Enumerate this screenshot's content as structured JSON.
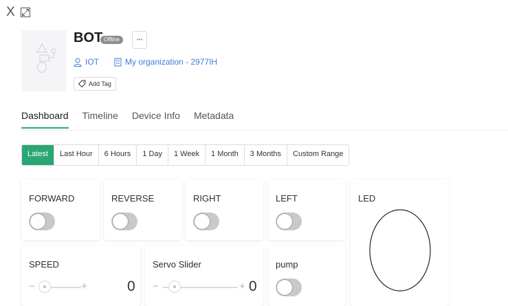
{
  "window": {
    "close_label": "X",
    "expand_icon": "expand-icon"
  },
  "device": {
    "name": "BOT",
    "status": "Offline",
    "more_label": "•••",
    "template": "IOT",
    "organization": "My organization - 2977IH",
    "add_tag_label": "Add Tag"
  },
  "tabs": [
    {
      "label": "Dashboard",
      "active": true
    },
    {
      "label": "Timeline",
      "active": false
    },
    {
      "label": "Device Info",
      "active": false
    },
    {
      "label": "Metadata",
      "active": false
    }
  ],
  "time_ranges": [
    {
      "label": "Latest",
      "active": true
    },
    {
      "label": "Last Hour",
      "active": false
    },
    {
      "label": "6 Hours",
      "active": false
    },
    {
      "label": "1 Day",
      "active": false
    },
    {
      "label": "1 Week",
      "active": false
    },
    {
      "label": "1 Month",
      "active": false
    },
    {
      "label": "3 Months",
      "active": false
    },
    {
      "label": "Custom Range",
      "active": false
    }
  ],
  "widgets": {
    "forward": {
      "label": "FORWARD",
      "on": false
    },
    "reverse": {
      "label": "REVERSE",
      "on": false
    },
    "right": {
      "label": "RIGHT",
      "on": false
    },
    "left": {
      "label": "LEFT",
      "on": false
    },
    "led": {
      "label": "LED",
      "on": false
    },
    "speed": {
      "label": "SPEED",
      "value": "0",
      "minus": "−",
      "plus": "+"
    },
    "servo": {
      "label": "Servo Slider",
      "value": "0",
      "minus": "−",
      "plus": "+"
    },
    "pump": {
      "label": "pump",
      "on": false
    }
  },
  "colors": {
    "accent": "#2aa675",
    "link": "#3d7fd6",
    "badge": "#8d8d92",
    "switch_off": "#c9c9cc"
  }
}
